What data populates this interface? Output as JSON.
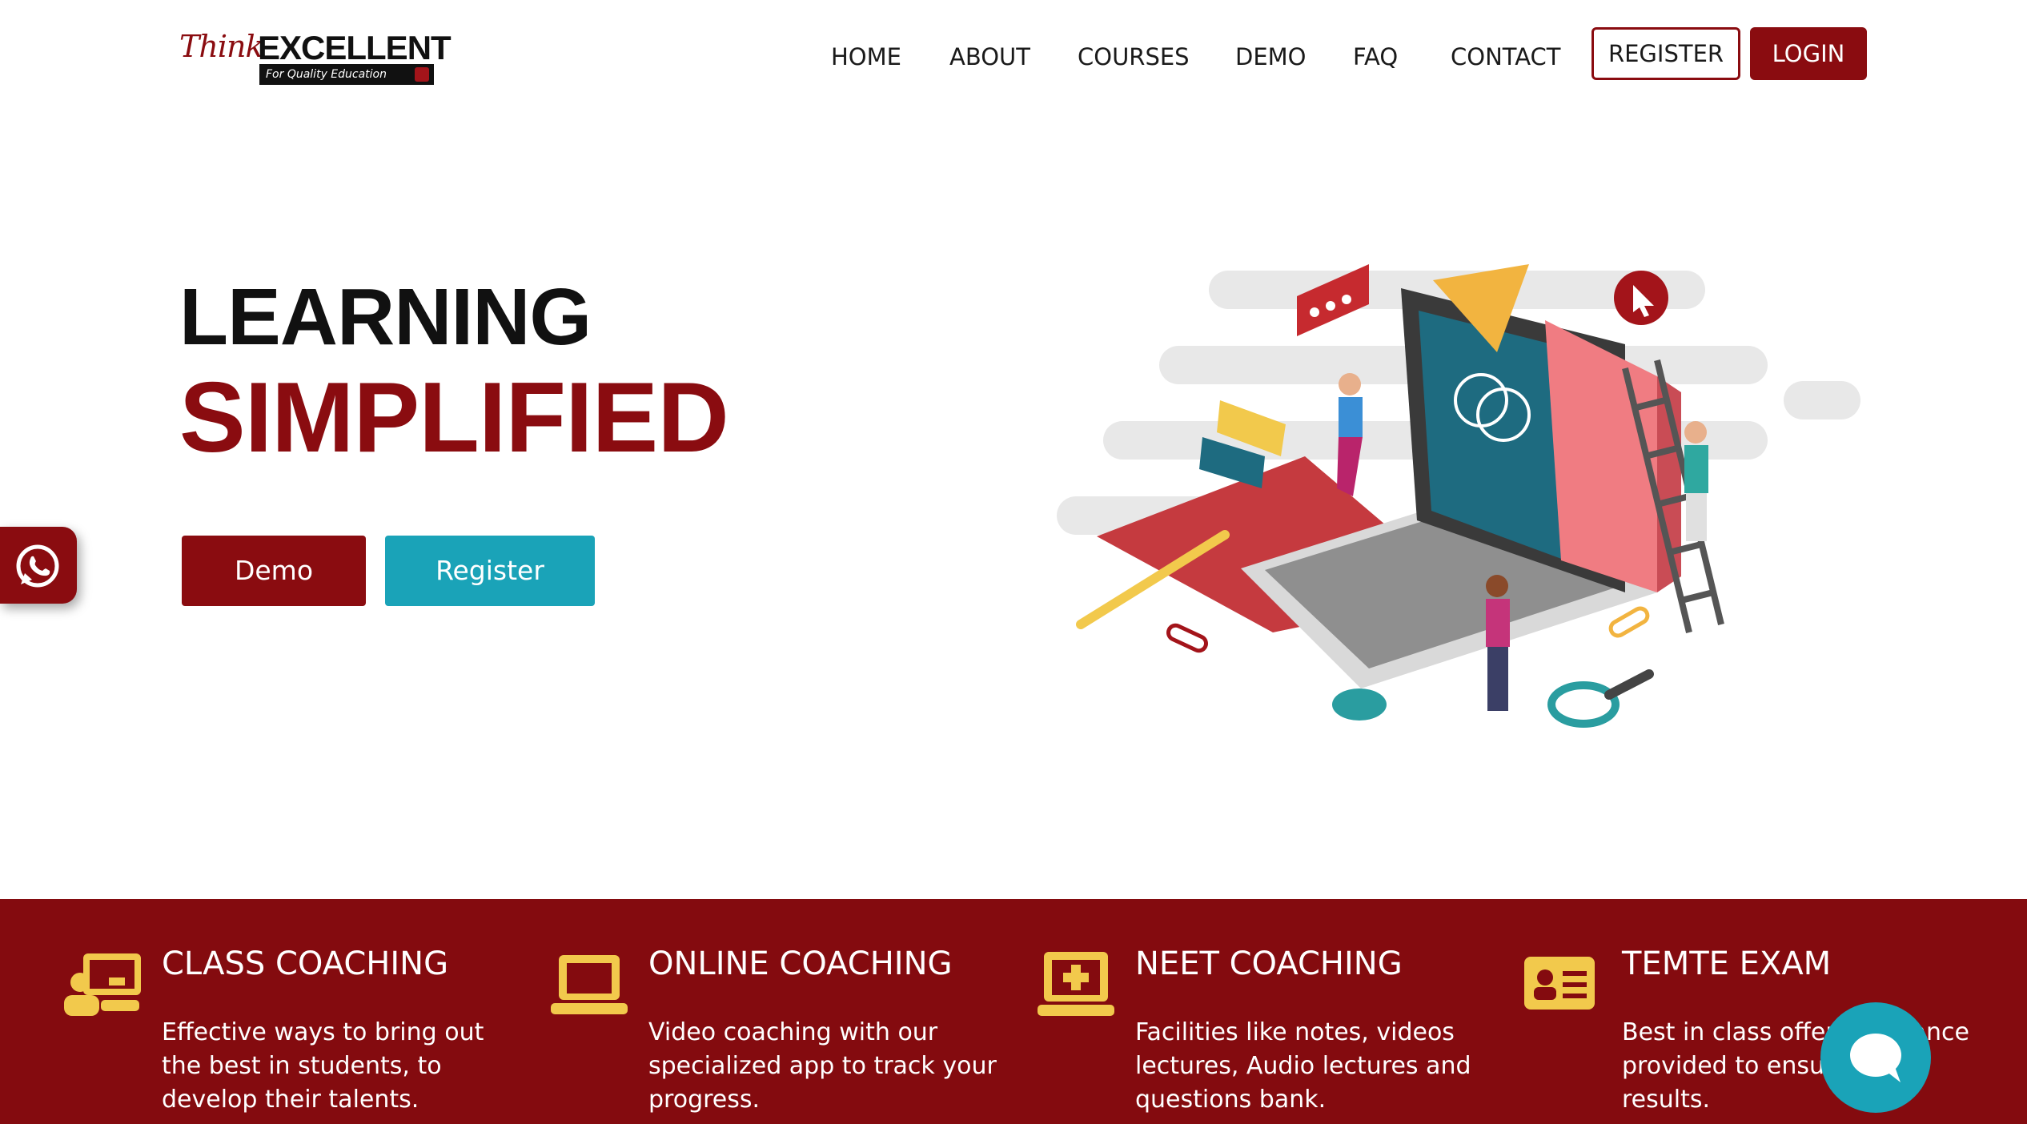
{
  "logo": {
    "think": "Think",
    "excellent": "EXCELLENT",
    "tagline": "For Quality Education"
  },
  "nav": {
    "items": [
      "HOME",
      "ABOUT",
      "COURSES",
      "DEMO",
      "FAQ",
      "CONTACT"
    ],
    "register": "REGISTER",
    "login": "LOGIN"
  },
  "hero": {
    "line1": "LEARNING",
    "line2": "SIMPLIFIED",
    "demo_button": "Demo",
    "register_button": "Register"
  },
  "services": [
    {
      "icon": "classroom-teacher-icon",
      "title": "CLASS COACHING",
      "desc": "Effective ways to bring out the best in students, to develop their talents."
    },
    {
      "icon": "laptop-icon",
      "title": "ONLINE COACHING",
      "desc": "Video coaching with our specialized app to track your progress."
    },
    {
      "icon": "medical-laptop-icon",
      "title": "NEET COACHING",
      "desc": "Facilities like notes, videos lectures, Audio lectures and questions bank."
    },
    {
      "icon": "id-card-icon",
      "title": "TEMTE EXAM",
      "desc": "Best in class offer assistance provided to ensure better results."
    }
  ],
  "colors": {
    "brand": "#8a0c10",
    "accent": "#1aa3b8",
    "band": "#840b0f",
    "icon": "#f2c94c"
  }
}
